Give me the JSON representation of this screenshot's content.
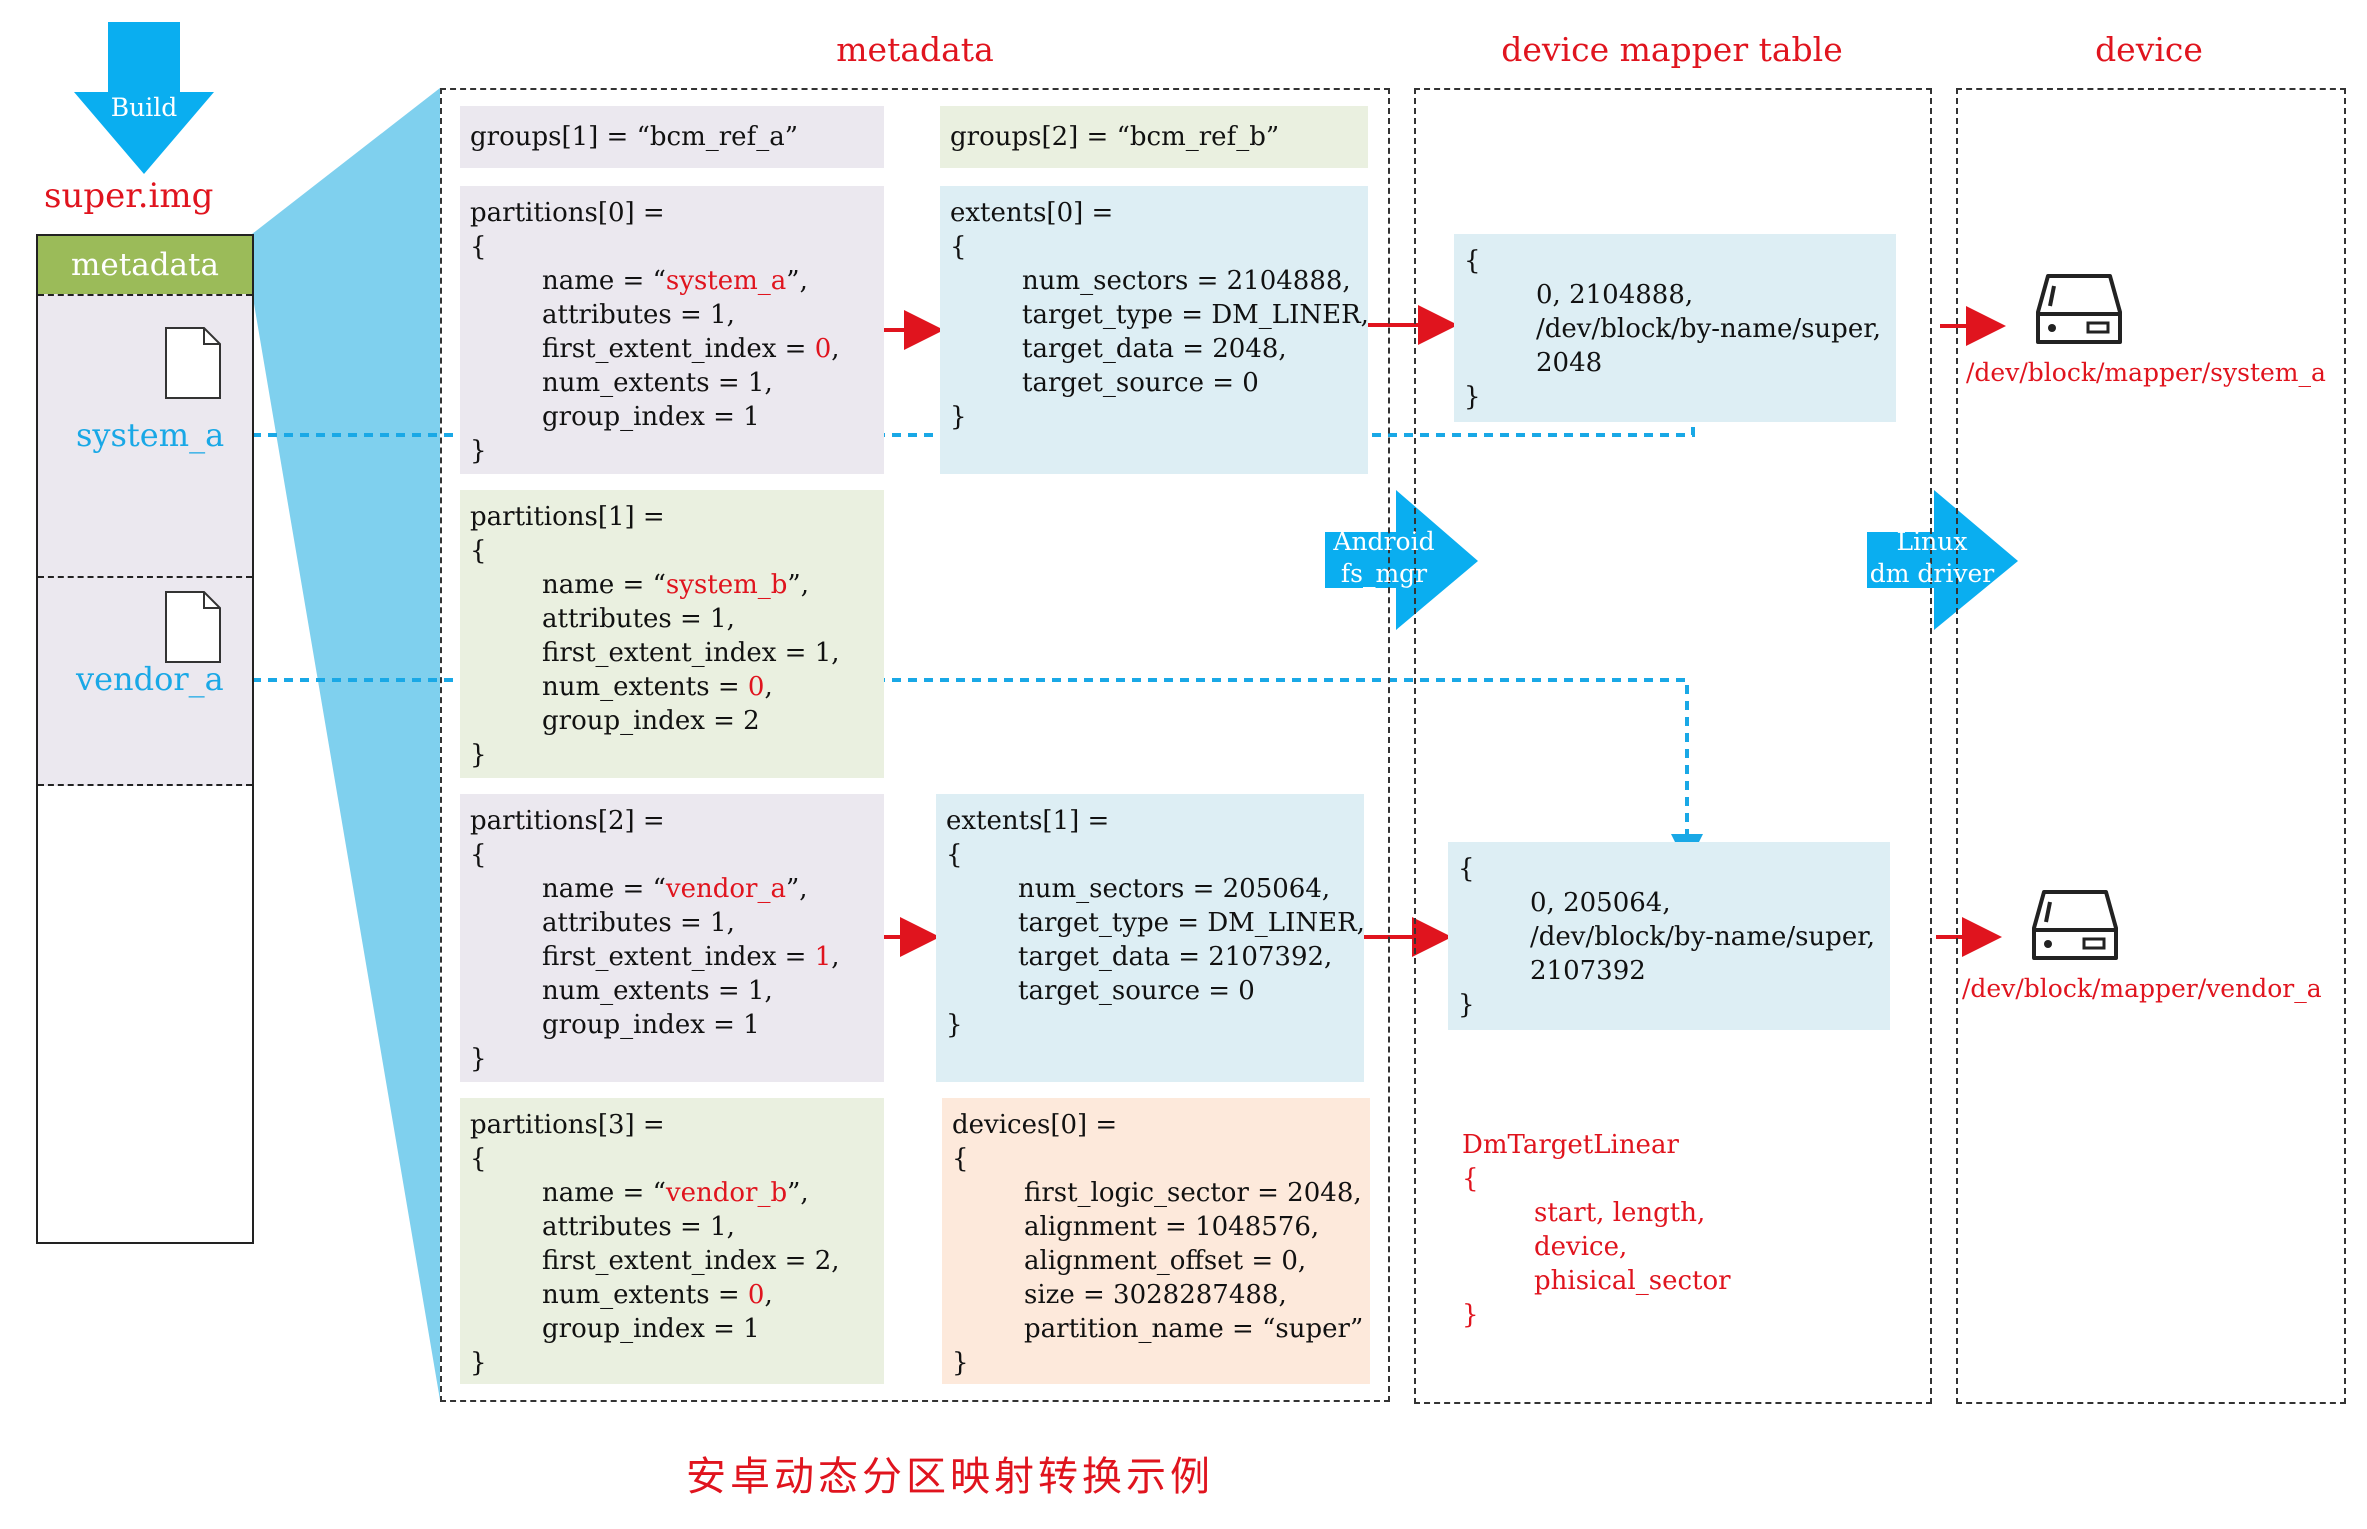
{
  "build_label": "Build",
  "super_img_label": "super.img",
  "left_column": {
    "metadata_label": "metadata",
    "system_a_label": "system_a",
    "vendor_a_label": "vendor_a"
  },
  "headers": {
    "metadata": "metadata",
    "dm_table": "device mapper table",
    "device": "device"
  },
  "groups": {
    "g1": "groups[1] = “bcm_ref_a”",
    "g2": "groups[2] = “bcm_ref_b”"
  },
  "partitions": [
    {
      "title": "partitions[0] =",
      "open": "{",
      "name_prefix": "name = “",
      "name_value": "system_a",
      "name_suffix": "”,",
      "attributes": "attributes = 1,",
      "fei_prefix": "first_extent_index = ",
      "fei_value": "0",
      "fei_suffix": ",",
      "ne_prefix": "num_extents = ",
      "ne_value": "1",
      "ne_suffix": ",",
      "group_index": "group_index = 1",
      "close": "}"
    },
    {
      "title": "partitions[1] =",
      "open": "{",
      "name_prefix": "name = “",
      "name_value": "system_b",
      "name_suffix": "”,",
      "attributes": "attributes = 1,",
      "fei_prefix": "first_extent_index = ",
      "fei_value": "1",
      "fei_suffix": ",",
      "ne_prefix": "num_extents = ",
      "ne_value": "0",
      "ne_suffix": ",",
      "group_index": "group_index = 2",
      "close": "}"
    },
    {
      "title": "partitions[2] =",
      "open": "{",
      "name_prefix": "name = “",
      "name_value": "vendor_a",
      "name_suffix": "”,",
      "attributes": "attributes = 1,",
      "fei_prefix": "first_extent_index = ",
      "fei_value": "1",
      "fei_suffix": ",",
      "ne_prefix": "num_extents = ",
      "ne_value": "1",
      "ne_suffix": ",",
      "group_index": "group_index = 1",
      "close": "}"
    },
    {
      "title": "partitions[3] =",
      "open": "{",
      "name_prefix": "name = “",
      "name_value": "vendor_b",
      "name_suffix": "”,",
      "attributes": "attributes = 1,",
      "fei_prefix": "first_extent_index = ",
      "fei_value": "2",
      "fei_suffix": ",",
      "ne_prefix": "num_extents = ",
      "ne_value": "0",
      "ne_suffix": ",",
      "group_index": "group_index = 1",
      "close": "}"
    }
  ],
  "extents": [
    {
      "title": "extents[0] =",
      "open": "{",
      "lines": [
        "num_sectors = 2104888,",
        "target_type = DM_LINER,",
        "target_data = 2048,",
        "target_source = 0"
      ],
      "close": "}"
    },
    {
      "title": "extents[1] =",
      "open": "{",
      "lines": [
        "num_sectors = 205064,",
        "target_type = DM_LINER,",
        "target_data = 2107392,",
        "target_source = 0"
      ],
      "close": "}"
    }
  ],
  "devices": {
    "title": "devices[0] =",
    "open": "{",
    "lines": [
      "first_logic_sector = 2048,",
      "alignment = 1048576,",
      "alignment_offset = 0,",
      "size = 3028287488,",
      "partition_name = “super”"
    ],
    "close": "}"
  },
  "dm_tables": [
    {
      "open": "{",
      "lines": [
        "0, 2104888,",
        "/dev/block/by-name/super,",
        "2048"
      ],
      "close": "}"
    },
    {
      "open": "{",
      "lines": [
        "0, 205064,",
        "/dev/block/by-name/super,",
        "2107392"
      ],
      "close": "}"
    }
  ],
  "dm_target_linear": {
    "title": "DmTargetLinear",
    "open": "{",
    "lines": [
      "start, length,",
      "device,",
      "phisical_sector"
    ],
    "close": "}"
  },
  "chevrons": {
    "android": [
      "Android",
      "fs_mgr"
    ],
    "linux": [
      "Linux",
      "dm driver"
    ]
  },
  "device_paths": {
    "system_a": "/dev/block/mapper/system_a",
    "vendor_a": "/dev/block/mapper/vendor_a"
  },
  "caption": "安卓动态分区映射转换示例",
  "colors": {
    "accent_red": "#e0141e",
    "cyan": "#19a8e6",
    "metadata_green": "#9bbb59",
    "light_blue_fan": "#7fd0ee"
  }
}
